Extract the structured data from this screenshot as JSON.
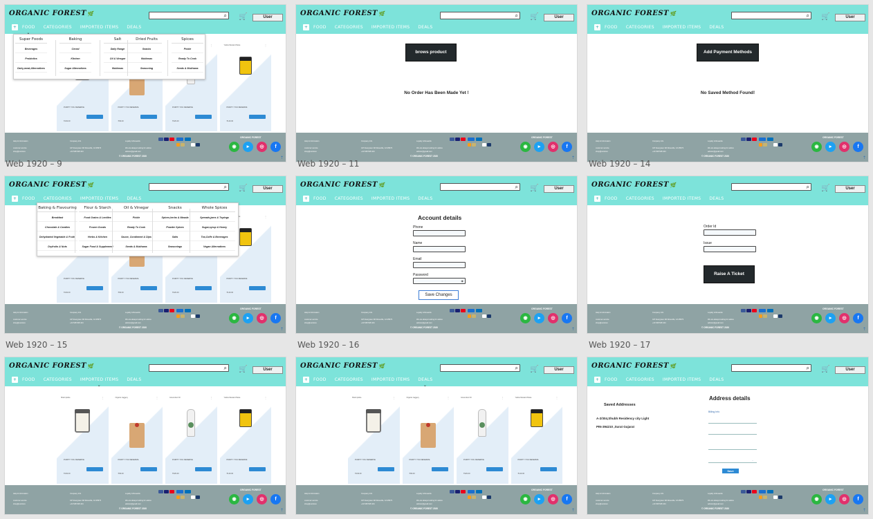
{
  "header": {
    "logo": "ORGANIC FOREST",
    "nav": {
      "food": "FOOD",
      "categories": "CATEGORIES",
      "imported": "IMPORTED ITEMS",
      "deals": "DEALS"
    },
    "user_button": "User",
    "search_placeholder": ""
  },
  "footer": {
    "help": "Help & Information",
    "help_sub1": "customer service",
    "help_sub2": "shop@ourstore",
    "company": "Company Info",
    "company_sub1": "447 Evergreen Rd Roseville, CA 95673",
    "company_sub2": "+44 548 548 444",
    "loyalty": "Loyalty & Rewards",
    "loyalty_sub1": "We are always looking for advice",
    "loyalty_sub2": "advisor@gmail.com",
    "brand": "ORGANIC FOREST",
    "copyright": "© ORGANIC FOREST 2020"
  },
  "frames": {
    "f9": {
      "label": "Web 1920 – 9"
    },
    "f11": {
      "label": "Web 1920 – 11",
      "button": "brows product",
      "message": "No Order Has Been Made Yet !"
    },
    "f14": {
      "label": "Web 1920 – 14",
      "button": "Add Payment Methods",
      "message": "No Saved Method Found!"
    },
    "f15": {
      "label": "Web 1920 – 15"
    },
    "f16": {
      "label": "Web 1920 – 16",
      "title": "Account details",
      "phone": "Phone",
      "name": "Name",
      "email": "Email",
      "password": "Password",
      "save": "Save Changes"
    },
    "f17": {
      "label": "Web 1920 – 17",
      "order_id": "Order Id",
      "issue": "Issue",
      "button": "Raise A Ticket"
    },
    "f18": {
      "label": ""
    },
    "f19": {
      "label": ""
    },
    "f20": {
      "label": "",
      "saved": "Saved Addresses",
      "addr1": "A-2/304,Shubh Residency city Light",
      "addr2": "PIN-394210 ,Surat Gujarat",
      "title": "Address details",
      "billing": "Billing Info",
      "save": "Save"
    }
  },
  "menus": {
    "food": [
      {
        "head": "Super Foods",
        "items": [
          "Beverages",
          "Probiotics",
          "Dairy,meat,Alternatives"
        ]
      },
      {
        "head": "Baking",
        "items": [
          "Cereal",
          "Kitchen",
          "Sugar Alternatives"
        ]
      },
      {
        "head": "Salt",
        "items": [
          "Daily Range",
          "Oil & Vinegar",
          "Mukhwas"
        ]
      },
      {
        "head": "Dried Fruits",
        "items": [
          "Snacks",
          "Mukhwas",
          "Seasoning"
        ]
      },
      {
        "head": "Spices",
        "items": [
          "Pickle",
          "Ready To Cook",
          "Seeds & Mukhwas"
        ]
      }
    ],
    "categories": [
      {
        "head": "Baking & Flavouring",
        "items": [
          "Breakfast",
          "Chocolate & Candies",
          "Dehydrated Vegetable & Fruits",
          "Dryfruits & Nuts"
        ]
      },
      {
        "head": "Flour & Starch",
        "items": [
          "Food Grains & Lentiles",
          "Frozen Goods",
          "Herbs & Kitchen",
          "Sugar Food & Supplement"
        ]
      },
      {
        "head": "Oil & Vinegar",
        "items": [
          "Pickle",
          "Ready To Cook",
          "Sauce, Condiment & Dips",
          "Seeds & Mukhwas"
        ]
      },
      {
        "head": "Snacks",
        "items": [
          "Spices,herbs & Masala",
          "Powder Spices",
          "Salts",
          "Seasonings"
        ]
      },
      {
        "head": "Whole Spices",
        "items": [
          "Spreads,jams & Topings",
          "Sugar,syrup & Honey",
          "Tea,Coffe & Beverages",
          "Vegan Alternatives"
        ]
      }
    ]
  },
  "products": [
    {
      "name": "Shahi pickle",
      "tag": "PURITY YOU DESERVE",
      "price": "₹249.00"
    },
    {
      "name": "Organic Jaggery",
      "tag": "PURITY YOU DESERVE",
      "price": "₹99.00"
    },
    {
      "name": "Groundnut Oil",
      "tag": "PURITY YOU DESERVE",
      "price": "₹329.00"
    },
    {
      "name": "Yellow Mustard Paste",
      "tag": "PURITY YOU DESERVE",
      "price": "₹149.00"
    }
  ]
}
